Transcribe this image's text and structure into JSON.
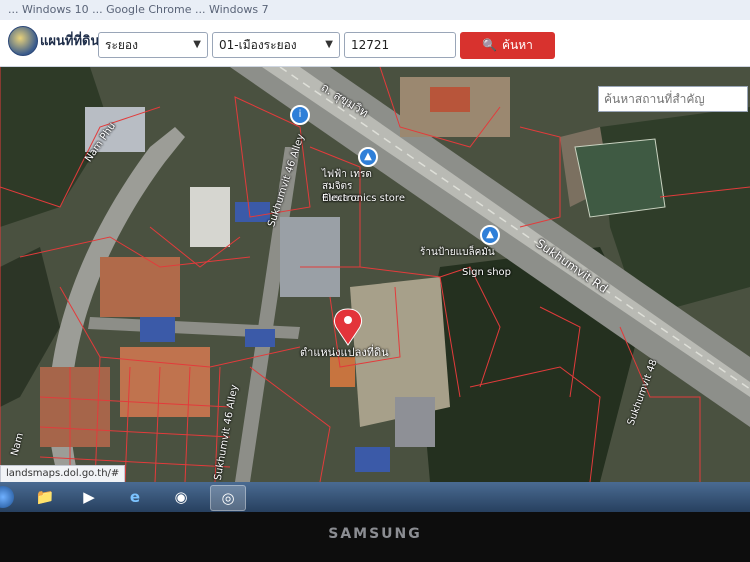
{
  "notice": "... Windows 10 ... Google Chrome ... Windows 7",
  "app": {
    "title": "แผนที่ที่ดิน"
  },
  "filters": {
    "province": "ระยอง",
    "district": "01-เมืองระยอง",
    "parcel_number": "12721",
    "search_label": "ค้นหา"
  },
  "map": {
    "place_search_placeholder": "ค้นหาสถานที่สำคัญ",
    "labels": {
      "sukhumvit_thai": "ถ. สุขุมวิท",
      "sukhumvit_rd": "Sukhumvit Rd",
      "sukhumvit_46_alley": "Sukhumvit 46 Alley",
      "sukhumvit_46_alley_low": "Sukhumvit 46 Alley",
      "sukhumvit_48": "Sukhumvit 48",
      "electronics_thai": "ไฟฟ้า เทรด สมจิตร ซัพพลาย",
      "electronics_en": "Electronics store",
      "sign_shop_thai": "ร้านป้ายแบล็คมัน",
      "sign_shop_en": "Sign shop",
      "parcel_location": "ตำแหน่งแปลงที่ดิน",
      "nam_phu": "Nam Phu",
      "nam": "Nam"
    }
  },
  "status_url": "landsmaps.dol.go.th/#",
  "taskbar": {
    "icons": [
      "start-orb-icon",
      "explorer-icon",
      "media-icon",
      "ie-icon",
      "photos-icon",
      "chrome-icon"
    ]
  },
  "monitor_brand": "SAMSUNG"
}
